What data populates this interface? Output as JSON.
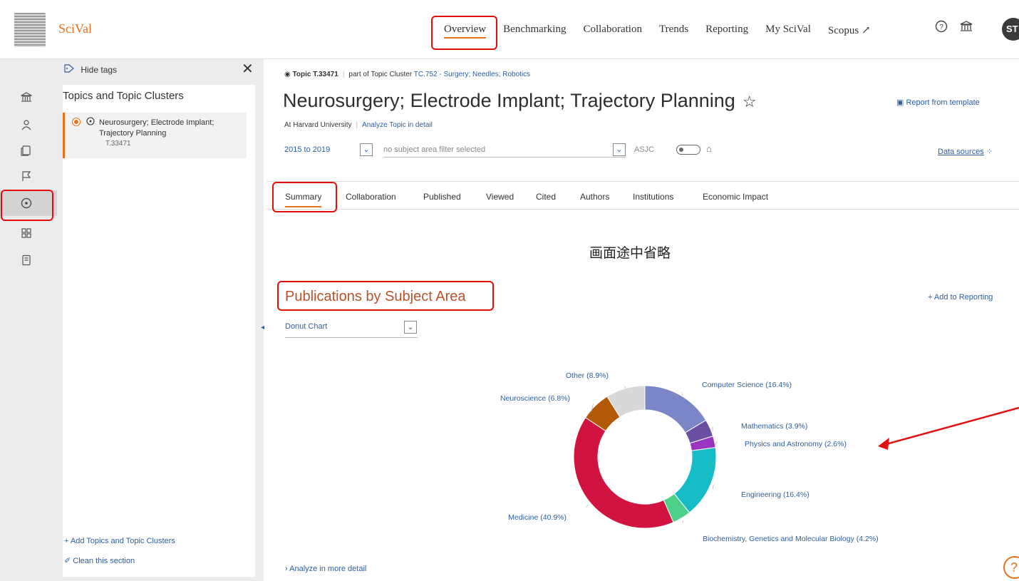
{
  "app": {
    "brand": "SciVal"
  },
  "topnav": {
    "items": [
      "Overview",
      "Benchmarking",
      "Collaboration",
      "Trends",
      "Reporting",
      "My SciVal",
      "Scopus ↗"
    ],
    "avatar": "ST"
  },
  "sidebar": {
    "hide_tags": "Hide tags",
    "heading": "Topics and Topic Clusters",
    "item": {
      "label": "Neurosurgery; Electrode Implant; Trajectory Planning",
      "id": "T.33471"
    },
    "add_link": "+ Add Topics and Topic Clusters",
    "clean_link": "Clean this section"
  },
  "topic": {
    "code": "Topic T.33471",
    "part_of": "part of Topic Cluster",
    "cluster": "TC.752 - Surgery; Needles; Robotics",
    "title": "Neurosurgery; Electrode Implant; Trajectory Planning",
    "institution": "At Harvard University",
    "analyze_link": "Analyze Topic in detail",
    "report_template": "Report from template",
    "date_range": "2015 to 2019",
    "subject_filter": "no subject area filter selected",
    "asjc": "ASJC",
    "data_sources": "Data sources"
  },
  "tabs": [
    "Summary",
    "Collaboration",
    "Published",
    "Viewed",
    "Cited",
    "Authors",
    "Institutions",
    "Economic Impact"
  ],
  "omitted_note": "画面途中省略",
  "section": {
    "title": "Publications by Subject Area",
    "add_reporting": "+ Add to Reporting",
    "chart_type": "Donut Chart",
    "analyze_more": "Analyze in more detail"
  },
  "chart_data": {
    "type": "pie",
    "title": "",
    "series": [
      {
        "name": "Computer Science (16.4%)",
        "value": 16.4,
        "color": "#7b86c8"
      },
      {
        "name": "Mathematics (3.9%)",
        "value": 3.9,
        "color": "#6a4fa3"
      },
      {
        "name": "Physics and Astronomy (2.6%)",
        "value": 2.6,
        "color": "#9b34c0"
      },
      {
        "name": "Engineering (16.4%)",
        "value": 16.4,
        "color": "#16bcc6"
      },
      {
        "name": "Biochemistry, Genetics and Molecular Biology (4.2%)",
        "value": 4.2,
        "color": "#4dd08a"
      },
      {
        "name": "Medicine (40.9%)",
        "value": 40.9,
        "color": "#d0143f"
      },
      {
        "name": "Neuroscience (6.8%)",
        "value": 6.8,
        "color": "#b35a06"
      },
      {
        "name": "Other (8.9%)",
        "value": 8.9,
        "color": "#d8d8d8"
      }
    ]
  },
  "colors": {
    "accent": "#e9711c",
    "link": "#2e5f9e",
    "annotation": "#e20f0f"
  }
}
